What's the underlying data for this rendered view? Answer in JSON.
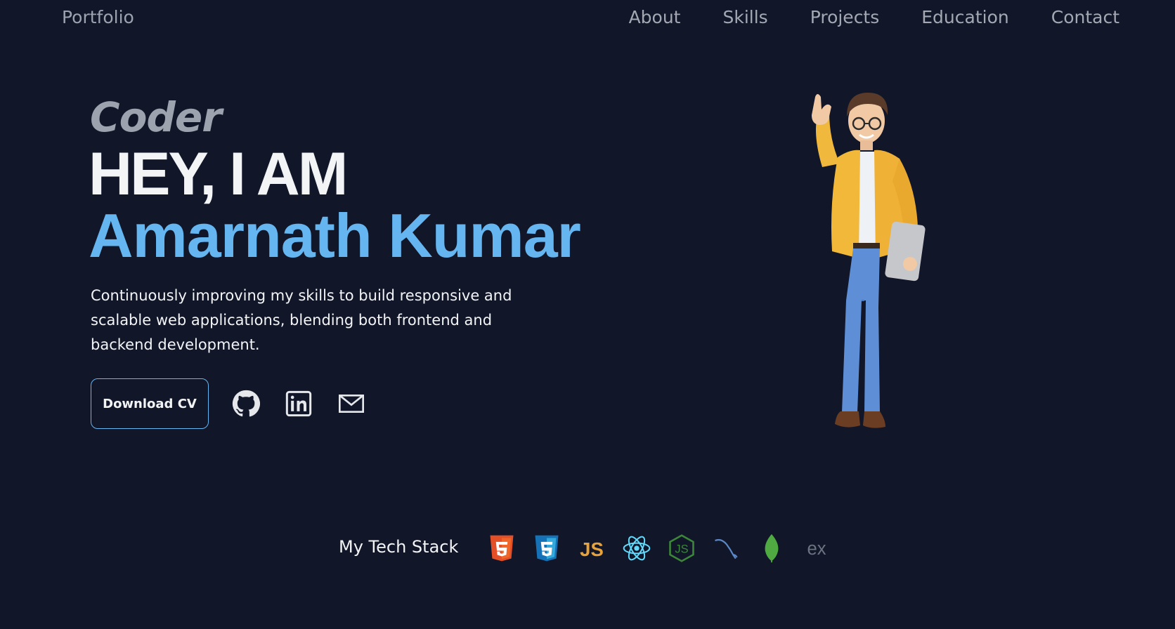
{
  "nav": {
    "brand": "Portfolio",
    "links": [
      "About",
      "Skills",
      "Projects",
      "Education",
      "Contact"
    ]
  },
  "hero": {
    "tagline": "Coder",
    "greeting": "HEY, I AM",
    "name": "Amarnath Kumar",
    "description": "Continuously improving my skills to build responsive and scalable web applications, blending both frontend and backend development.",
    "cv_button": "Download CV",
    "social_icons": [
      "github-icon",
      "linkedin-icon",
      "mail-icon"
    ]
  },
  "illustration": {
    "icon": "waving-man-avatar"
  },
  "tech_stack": {
    "label": "My Tech Stack",
    "icons": [
      "html5-icon",
      "css3-icon",
      "javascript-icon",
      "react-icon",
      "nodejs-icon",
      "mysql-icon",
      "mongodb-icon",
      "express-icon"
    ]
  },
  "colors": {
    "background": "#111629",
    "accent": "#64b5f0",
    "muted": "#9ca3af",
    "text": "#f3f4f6"
  }
}
